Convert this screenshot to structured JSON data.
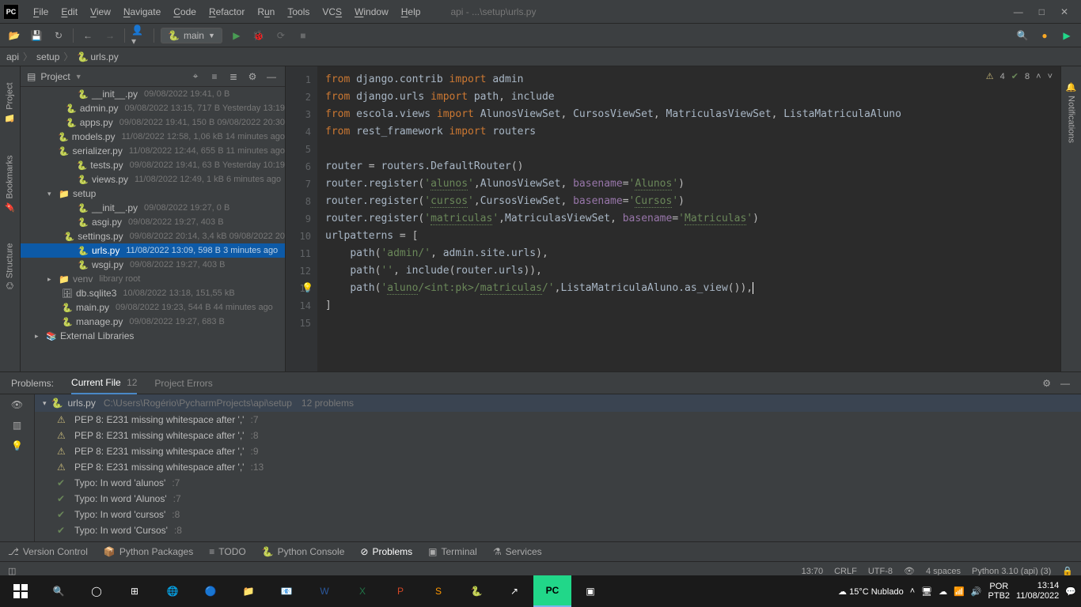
{
  "titlebar": {
    "logo": "PC",
    "menu": [
      "File",
      "Edit",
      "View",
      "Navigate",
      "Code",
      "Refactor",
      "Run",
      "Tools",
      "VCS",
      "Window",
      "Help"
    ],
    "title": "api - ...\\setup\\urls.py"
  },
  "toolbar": {
    "run_config_label": "main"
  },
  "breadcrumbs": [
    "api",
    "setup",
    "urls.py"
  ],
  "project": {
    "header_label": "Project",
    "items": [
      {
        "indent": 60,
        "icon": "py",
        "name": "__init__.py",
        "meta": "09/08/2022 19:41, 0 B"
      },
      {
        "indent": 60,
        "icon": "py",
        "name": "admin.py",
        "meta": "09/08/2022 13:15, 717 B Yesterday 13:19"
      },
      {
        "indent": 60,
        "icon": "py",
        "name": "apps.py",
        "meta": "09/08/2022 19:41, 150 B 09/08/2022 20:30"
      },
      {
        "indent": 60,
        "icon": "py",
        "name": "models.py",
        "meta": "11/08/2022 12:58, 1,06 kB 14 minutes ago"
      },
      {
        "indent": 60,
        "icon": "py",
        "name": "serializer.py",
        "meta": "11/08/2022 12:44, 655 B 11 minutes ago"
      },
      {
        "indent": 60,
        "icon": "py",
        "name": "tests.py",
        "meta": "09/08/2022 19:41, 63 B Yesterday 10:19"
      },
      {
        "indent": 60,
        "icon": "py",
        "name": "views.py",
        "meta": "11/08/2022 12:49, 1 kB 6 minutes ago"
      },
      {
        "indent": 22,
        "arrow": "▾",
        "icon": "folder",
        "name": "setup",
        "meta": ""
      },
      {
        "indent": 60,
        "icon": "py",
        "name": "__init__.py",
        "meta": "09/08/2022 19:27, 0 B"
      },
      {
        "indent": 60,
        "icon": "py",
        "name": "asgi.py",
        "meta": "09/08/2022 19:27, 403 B"
      },
      {
        "indent": 60,
        "icon": "py",
        "name": "settings.py",
        "meta": "09/08/2022 20:14, 3,4 kB 09/08/2022 20"
      },
      {
        "indent": 60,
        "icon": "py",
        "name": "urls.py",
        "meta": "11/08/2022 13:09, 598 B 3 minutes ago",
        "selected": true
      },
      {
        "indent": 60,
        "icon": "py",
        "name": "wsgi.py",
        "meta": "09/08/2022 19:27, 403 B"
      },
      {
        "indent": 22,
        "arrow": "▸",
        "icon": "folder",
        "name": "venv",
        "meta": "library root",
        "lib": true
      },
      {
        "indent": 40,
        "icon": "db",
        "name": "db.sqlite3",
        "meta": "10/08/2022 13:18, 151,55 kB"
      },
      {
        "indent": 40,
        "icon": "py",
        "name": "main.py",
        "meta": "09/08/2022 19:23, 544 B 44 minutes ago"
      },
      {
        "indent": 40,
        "icon": "py",
        "name": "manage.py",
        "meta": "09/08/2022 19:27, 683 B"
      },
      {
        "indent": 6,
        "arrow": "▸",
        "icon": "lib",
        "name": "External Libraries",
        "meta": ""
      }
    ]
  },
  "editor": {
    "warn_count": "4",
    "ok_count": "8",
    "lines": 15
  },
  "problems": {
    "panel_label": "Problems:",
    "tab_current": "Current File",
    "tab_current_count": "12",
    "tab_errors": "Project Errors",
    "file_name": "urls.py",
    "file_path": "C:\\Users\\Rogério\\PycharmProjects\\api\\setup",
    "file_count": "12 problems",
    "items": [
      {
        "type": "warn",
        "text": "PEP 8: E231 missing whitespace after ','",
        "loc": ":7"
      },
      {
        "type": "warn",
        "text": "PEP 8: E231 missing whitespace after ','",
        "loc": ":8"
      },
      {
        "type": "warn",
        "text": "PEP 8: E231 missing whitespace after ','",
        "loc": ":9"
      },
      {
        "type": "warn",
        "text": "PEP 8: E231 missing whitespace after ','",
        "loc": ":13"
      },
      {
        "type": "typo",
        "text": "Typo: In word 'alunos'",
        "loc": ":7"
      },
      {
        "type": "typo",
        "text": "Typo: In word 'Alunos'",
        "loc": ":7"
      },
      {
        "type": "typo",
        "text": "Typo: In word 'cursos'",
        "loc": ":8"
      },
      {
        "type": "typo",
        "text": "Typo: In word 'Cursos'",
        "loc": ":8"
      }
    ]
  },
  "bottom_tools": {
    "version_control": "Version Control",
    "python_packages": "Python Packages",
    "todo": "TODO",
    "python_console": "Python Console",
    "problems": "Problems",
    "terminal": "Terminal",
    "services": "Services"
  },
  "status": {
    "pos": "13:70",
    "sep": "CRLF",
    "enc": "UTF-8",
    "indent": "4 spaces",
    "interp": "Python 3.10 (api) (3)"
  },
  "taskbar": {
    "weather": "15°C  Nublado",
    "lang1": "POR",
    "lang2": "PTB2",
    "time": "13:14",
    "date": "11/08/2022"
  },
  "left_tools": {
    "project": "Project",
    "bookmarks": "Bookmarks",
    "structure": "Structure"
  },
  "right_tools": {
    "notifications": "Notifications"
  }
}
